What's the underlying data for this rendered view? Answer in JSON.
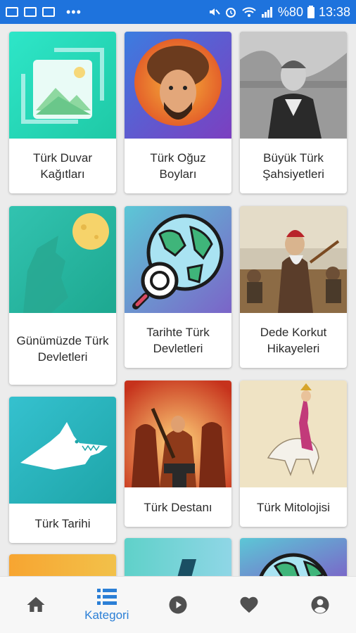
{
  "status_bar": {
    "battery_text": "%80",
    "time": "13:38",
    "more_glyph": "•••"
  },
  "categories": [
    {
      "label": "Türk Duvar Kağıtları",
      "icon": "image-placeholder-icon"
    },
    {
      "label": "Türk Oğuz Boyları",
      "icon": "oghuz-portrait"
    },
    {
      "label": "Büyük Türk Şahsiyetleri",
      "icon": "historical-portrait"
    },
    {
      "label": "Günümüzde Türk Devletleri",
      "icon": "wolf-moon-icon"
    },
    {
      "label": "Tarihte Türk Devletleri",
      "icon": "globe-search-icon"
    },
    {
      "label": "Dede Korkut Hikayeleri",
      "icon": "dede-korkut-painting"
    },
    {
      "label": "Türk Tarihi",
      "icon": "wolf-head-icon"
    },
    {
      "label": "Türk Destanı",
      "icon": "blacksmith-painting"
    },
    {
      "label": "Türk Mitolojisi",
      "icon": "mythology-illustration"
    }
  ],
  "bottom_nav": {
    "home_icon": "home-icon",
    "kategori_label": "Kategori",
    "play_icon": "play-circle-icon",
    "favorites_icon": "heart-icon",
    "profile_icon": "account-circle-icon"
  },
  "colors": {
    "status_bar": "#1e73dd",
    "accent": "#2b7fd6",
    "background": "#ececec"
  }
}
